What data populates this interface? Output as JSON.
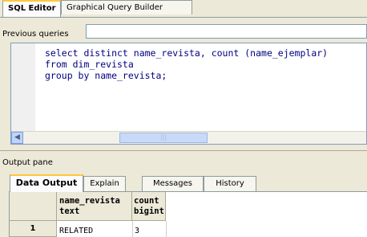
{
  "editor_tabs": [
    {
      "label": "SQL Editor",
      "selected": true
    },
    {
      "label": "Graphical Query Builder",
      "selected": false
    }
  ],
  "previous_queries": {
    "label": "Previous queries",
    "value": ""
  },
  "editor": {
    "lines": [
      "select distinct name_revista, count (name_ejemplar)",
      "from dim_revista",
      "group by name_revista;"
    ],
    "scroll_left_icon": "arrow-left-icon",
    "thumb_grip": "|||"
  },
  "output": {
    "title": "Output pane",
    "tabs": [
      {
        "label": "Data Output",
        "selected": true
      },
      {
        "label": "Explain",
        "selected": false
      },
      {
        "label": "Messages",
        "selected": false
      },
      {
        "label": "History",
        "selected": false
      }
    ],
    "columns": [
      {
        "name": "name_revista",
        "type": "text"
      },
      {
        "name": "count",
        "type": "bigint"
      }
    ],
    "rows": [
      {
        "num": "1",
        "cells": [
          "RELATED",
          "3"
        ]
      }
    ]
  },
  "colors": {
    "tab_highlight": "#ffc83c",
    "code_text": "#000080",
    "background": "#ece9d8"
  }
}
